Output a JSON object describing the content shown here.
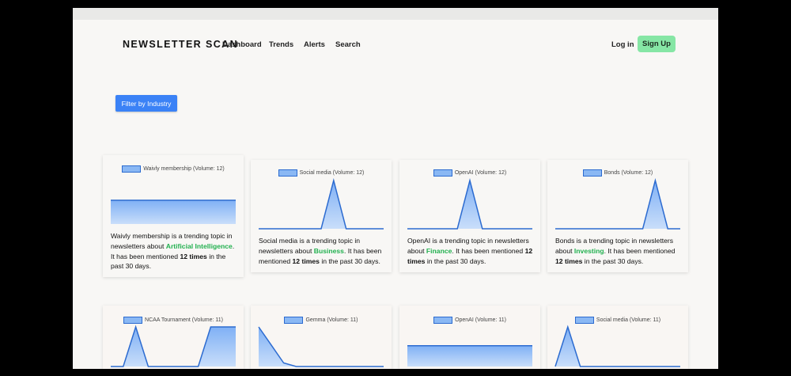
{
  "header": {
    "brand": "NEWSLETTER SCAN",
    "nav": [
      "Dashboard",
      "Trends",
      "Alerts",
      "Search"
    ],
    "login": "Log in",
    "signup": "Sign Up"
  },
  "filter_label": "Filter by Industry",
  "colors": {
    "line": "#2c6bd0",
    "fill": "#8ab8f4",
    "industry": "#22b04f",
    "signup": "#86e6a5",
    "filter": "#3b82f6"
  },
  "cards": [
    {
      "legend": "Waivly membership (Volume: 12)",
      "topic": "Waivly membership",
      "t1": " is a trending topic in newsletters about ",
      "industry": "Artificial Intelligence",
      "t2": ". It has been mentioned ",
      "count": "12 times",
      "t3": " in the past 30 days.",
      "values": [
        12,
        12,
        12,
        12,
        12,
        12,
        12,
        12,
        12,
        12,
        12
      ],
      "ylim": [
        0,
        22
      ]
    },
    {
      "legend": "Social media (Volume: 12)",
      "topic": "Social media",
      "t1": " is a trending topic in newsletters about ",
      "industry": "Business",
      "t2": ". It has been mentioned ",
      "count": "12 times",
      "t3": " in the past 30 days.",
      "values": [
        0,
        0,
        0,
        0,
        0,
        0,
        12,
        0,
        0,
        0,
        0
      ],
      "ylim": [
        0,
        12
      ]
    },
    {
      "legend": "OpenAI (Volume: 12)",
      "topic": "OpenAI",
      "t1": " is a trending topic in newsletters about ",
      "industry": "Finance",
      "t2": ". It has been mentioned ",
      "count": "12 times",
      "t3": " in the past 30 days.",
      "values": [
        0,
        0,
        0,
        0,
        0,
        12,
        0,
        0,
        0,
        0,
        0
      ],
      "ylim": [
        0,
        12
      ]
    },
    {
      "legend": "Bonds (Volume: 12)",
      "topic": "Bonds",
      "t1": " is a trending topic in newsletters about ",
      "industry": "Investing",
      "t2": ". It has been mentioned ",
      "count": "12 times",
      "t3": " in the past 30 days.",
      "values": [
        0,
        0,
        0,
        0,
        0,
        0,
        0,
        0,
        12,
        0,
        0
      ],
      "ylim": [
        0,
        12
      ]
    },
    {
      "legend": "NCAA Tournament (Volume: 11)",
      "values": [
        0,
        0,
        11,
        0,
        0,
        0,
        0,
        0,
        11,
        11,
        11
      ],
      "ylim": [
        0,
        11
      ]
    },
    {
      "legend": "Gemma (Volume: 11)",
      "values": [
        11,
        6,
        1,
        0,
        0,
        0,
        0,
        0,
        0,
        0,
        0
      ],
      "ylim": [
        0,
        11
      ]
    },
    {
      "legend": "OpenAI (Volume: 11)",
      "values": [
        11,
        11,
        11,
        11,
        11,
        11,
        11,
        11,
        11,
        11,
        11
      ],
      "ylim": [
        0,
        21
      ]
    },
    {
      "legend": "Social media (Volume: 11)",
      "values": [
        0,
        11,
        0,
        0,
        0,
        0,
        0,
        0,
        0,
        0,
        0
      ],
      "ylim": [
        0,
        11
      ]
    }
  ]
}
